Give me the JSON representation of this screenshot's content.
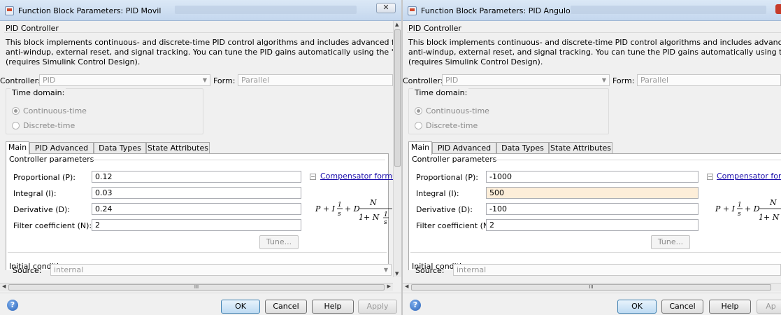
{
  "windows": [
    {
      "title": "Function Block Parameters: PID Movil",
      "close_glyph": "✕",
      "section_title": "PID Controller",
      "description": [
        "This block implements continuous- and discrete-time PID control algorithms and includes advanced features such as",
        "anti-windup, external reset, and signal tracking. You can tune the PID gains automatically using the 'Tune...' button",
        "(requires Simulink Control Design)."
      ],
      "controller_label": "Controller:",
      "controller_value": "PID",
      "form_label": "Form:",
      "form_value": "Parallel",
      "time_domain_label": "Time domain:",
      "continuous_label": "Continuous-time",
      "discrete_label": "Discrete-time",
      "tabs": [
        "Main",
        "PID Advanced",
        "Data Types",
        "State Attributes"
      ],
      "controller_params_label": "Controller parameters",
      "params": [
        {
          "label": "Proportional (P):",
          "value": "0.12"
        },
        {
          "label": "Integral (I):",
          "value": "0.03"
        },
        {
          "label": "Derivative (D):",
          "value": "0.24"
        },
        {
          "label": "Filter coefficient (N):",
          "value": "2"
        }
      ],
      "compensator_link": "Compensator formula",
      "tune_label": "Tune...",
      "initial_conditions_label": "Initial conditions",
      "source_label": "Source:",
      "source_value": "internal",
      "hscroll_glyph": "III",
      "buttons": {
        "ok": "OK",
        "cancel": "Cancel",
        "help": "Help",
        "apply": "Apply"
      }
    },
    {
      "title": "Function Block Parameters: PID Angulo",
      "section_title": "PID Controller",
      "description": [
        "This block implements continuous- and discrete-time PID control algorithms and includes advanced features suc",
        "anti-windup, external reset, and signal tracking. You can tune the PID gains automatically using the 'Tune...' butt",
        "(requires Simulink Control Design)."
      ],
      "controller_label": "Controller:",
      "controller_value": "PID",
      "form_label": "Form:",
      "form_value": "Parallel",
      "time_domain_label": "Time domain:",
      "continuous_label": "Continuous-time",
      "discrete_label": "Discrete-time",
      "tabs": [
        "Main",
        "PID Advanced",
        "Data Types",
        "State Attributes"
      ],
      "controller_params_label": "Controller parameters",
      "params": [
        {
          "label": "Proportional (P):",
          "value": "-1000"
        },
        {
          "label": "Integral (I):",
          "value": "500"
        },
        {
          "label": "Derivative (D):",
          "value": "-100"
        },
        {
          "label": "Filter coefficient (N):",
          "value": "2"
        }
      ],
      "compensator_link": "Compensator form",
      "tune_label": "Tune...",
      "initial_conditions_label": "Initial conditions",
      "source_label": "Source:",
      "source_value": "internal",
      "hscroll_glyph": "III",
      "buttons": {
        "ok": "OK",
        "cancel": "Cancel",
        "help": "Help",
        "apply": "Ap"
      }
    }
  ]
}
